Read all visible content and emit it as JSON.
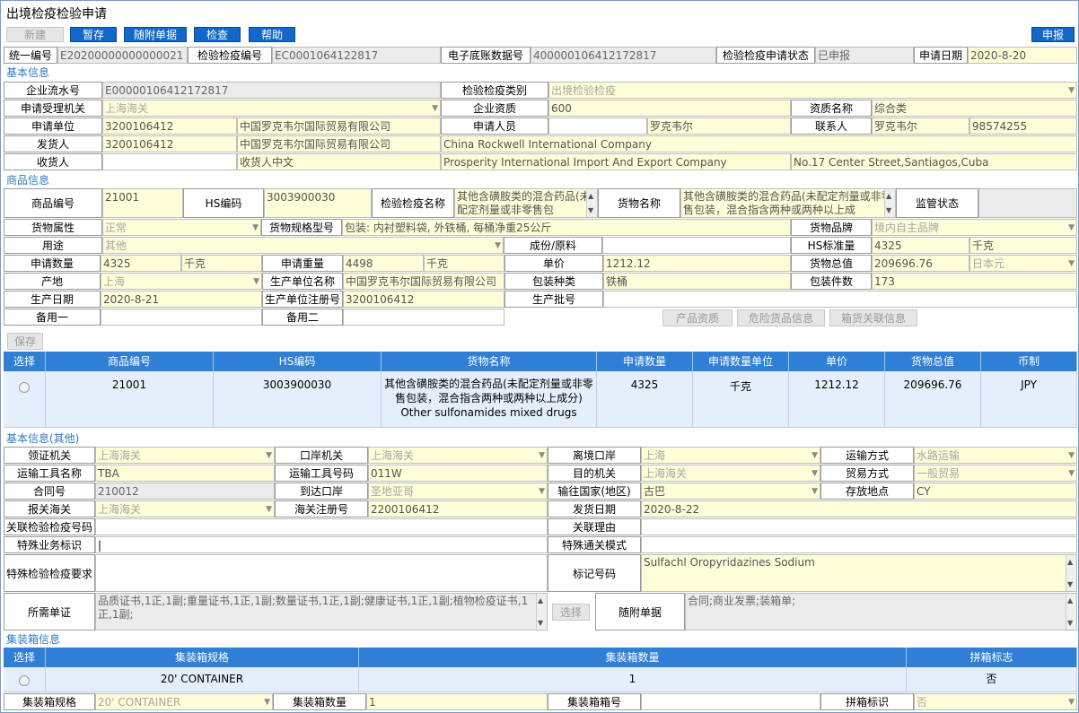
{
  "window": {
    "title": "出境检疫检验申请"
  },
  "toolbar": {
    "new": "新建",
    "save": "暂存",
    "attach": "随附单据",
    "check": "检查",
    "help": "帮助",
    "apply": "申报"
  },
  "header": {
    "unified_no_label": "统一编号",
    "unified_no": "E20200000000000021",
    "insp_no_label": "检验检疫编号",
    "insp_no": "EC0001064122817",
    "ledger_label": "电子底账数据号",
    "ledger": "400000106412172817",
    "status_label": "检验检疫申请状态",
    "status": "已申报",
    "date_label": "申请日期",
    "date": "2020-8-20"
  },
  "basic": {
    "section": "基本信息",
    "serial_label": "企业流水号",
    "serial": "E00000106412172817",
    "category_label": "检验检疫类别",
    "category": "出境检验检疫",
    "org_label": "申请受理机关",
    "org": "上海海关",
    "qual_label": "企业资质",
    "qual": "600",
    "qualname_label": "资质名称",
    "qualname": "综合类",
    "unit_label": "申请单位",
    "unit_code": "3200106412",
    "unit_name": "中国罗克韦尔国际贸易有限公司",
    "applicant_label": "申请人员",
    "applicant": "罗克韦尔",
    "contact_label": "联系人",
    "contact": "罗克韦尔",
    "phone": "98574255",
    "shipper_label": "发货人",
    "shipper_code": "3200106412",
    "shipper_cn": "中国罗克韦尔国际贸易有限公司",
    "shipper_en": "China Rockwell International Company",
    "consignee_label": "收货人",
    "consignee_cn": "收货人中文",
    "consignee_en": "Prosperity International Import And Export Company",
    "consignee_addr": "No.17 Center Street,Santiagos,Cuba"
  },
  "goods": {
    "section": "商品信息",
    "code_label": "商品编号",
    "code": "21001",
    "hs_label": "HS编码",
    "hs": "3003900030",
    "inspname_label": "检验检疫名称",
    "inspname": "其他含磺胺类的混合药品(未配定剂量或非零售包",
    "name_label": "货物名称",
    "name": "其他含磺胺类的混合药品(未配定剂量或非零售包装，混合指含两种或两种以上成",
    "supervise_label": "监管状态",
    "attr_label": "货物属性",
    "attr": "正常",
    "spec_label": "货物规格型号",
    "spec": "包装: 内衬塑料袋, 外铁桶, 每桶净重25公斤",
    "brand_label": "货物品牌",
    "brand": "境内自主品牌",
    "use_label": "用途",
    "use": "其他",
    "material_label": "成份/原料",
    "hsstd_label": "HS标准量",
    "hsstd": "4325",
    "hsstd_unit": "千克",
    "qty_label": "申请数量",
    "qty": "4325",
    "qty_unit": "千克",
    "weight_label": "申请重量",
    "weight": "4498",
    "weight_unit": "千克",
    "price_label": "单价",
    "price": "1212.12",
    "total_label": "货物总值",
    "total": "209696.76",
    "currency": "日本元",
    "origin_label": "产地",
    "origin": "上海",
    "producer_label": "生产单位名称",
    "producer": "中国罗克韦尔国际贸易有限公司",
    "pack_label": "包装种类",
    "pack": "铁桶",
    "packnum_label": "包装件数",
    "packnum": "173",
    "proddate_label": "生产日期",
    "proddate": "2020-8-21",
    "prodreg_label": "生产单位注册号",
    "prodreg": "3200106412",
    "batch_label": "生产批号",
    "spare1_label": "备用一",
    "spare2_label": "备用二",
    "btn_qual": "产品资质",
    "btn_danger": "危险货品信息",
    "btn_box": "箱货关联信息",
    "btn_save": "保存"
  },
  "table": {
    "headers": [
      "选择",
      "商品编号",
      "HS编码",
      "货物名称",
      "申请数量",
      "申请数量单位",
      "单价",
      "货物总值",
      "币制"
    ],
    "row": {
      "code": "21001",
      "hs": "3003900030",
      "name": "其他含磺胺类的混合药品(未配定剂量或非零售包装，混合指含两种或两种以上成分)",
      "name_en": "Other sulfonamides mixed drugs",
      "qty": "4325",
      "unit": "千克",
      "price": "1212.12",
      "total": "209696.76",
      "currency": "JPY"
    }
  },
  "other": {
    "section": "基本信息(其他)",
    "cert_org_label": "领证机关",
    "cert_org": "上海海关",
    "port_org_label": "口岸机关",
    "port_org": "上海海关",
    "exit_port_label": "离境口岸",
    "exit_port": "上海",
    "transport_label": "运输方式",
    "transport": "水路运输",
    "vehicle_label": "运输工具名称",
    "vehicle": "TBA",
    "vehicle_no_label": "运输工具号码",
    "vehicle_no": "011W",
    "dest_org_label": "目的机关",
    "dest_org": "上海海关",
    "trade_label": "贸易方式",
    "trade": "一般贸易",
    "contract_label": "合同号",
    "contract": "210012",
    "arrival_label": "到达口岸",
    "arrival": "圣地亚哥",
    "country_label": "输往国家(地区)",
    "country": "古巴",
    "storage_label": "存放地点",
    "storage": "CY",
    "customs_label": "报关海关",
    "customs": "上海海关",
    "reg_label": "海关注册号",
    "reg": "2200106412",
    "ship_date_label": "发货日期",
    "ship_date": "2020-8-22",
    "rel_no_label": "关联检验检疫号码",
    "rel_reason_label": "关联理由",
    "special_label": "特殊业务标识",
    "special_mode_label": "特殊通关模式",
    "special_req_label": "特殊检验检疫要求",
    "mark_label": "标记号码",
    "mark": "Sulfachl Oropyridazines Sodium",
    "docs_label": "所需单证",
    "docs": "品质证书,1正,1副;重量证书,1正,1副;数量证书,1正,1副;健康证书,1正,1副;植物检疫证书,1正,1副;",
    "select_btn": "选择",
    "attach_label": "随附单据",
    "attach": "合同;商业发票;装箱单;"
  },
  "container": {
    "section": "集装箱信息",
    "headers": [
      "选择",
      "集装箱规格",
      "集装箱数量",
      "拼箱标志"
    ],
    "row": {
      "spec": "20' CONTAINER",
      "qty": "1",
      "lcl": "否"
    },
    "spec_label": "集装箱规格",
    "spec": "20' CONTAINER",
    "qty_label": "集装箱数量",
    "qty": "1",
    "boxno_label": "集装箱箱号",
    "lcl_label": "拼箱标识",
    "lcl": "否"
  }
}
